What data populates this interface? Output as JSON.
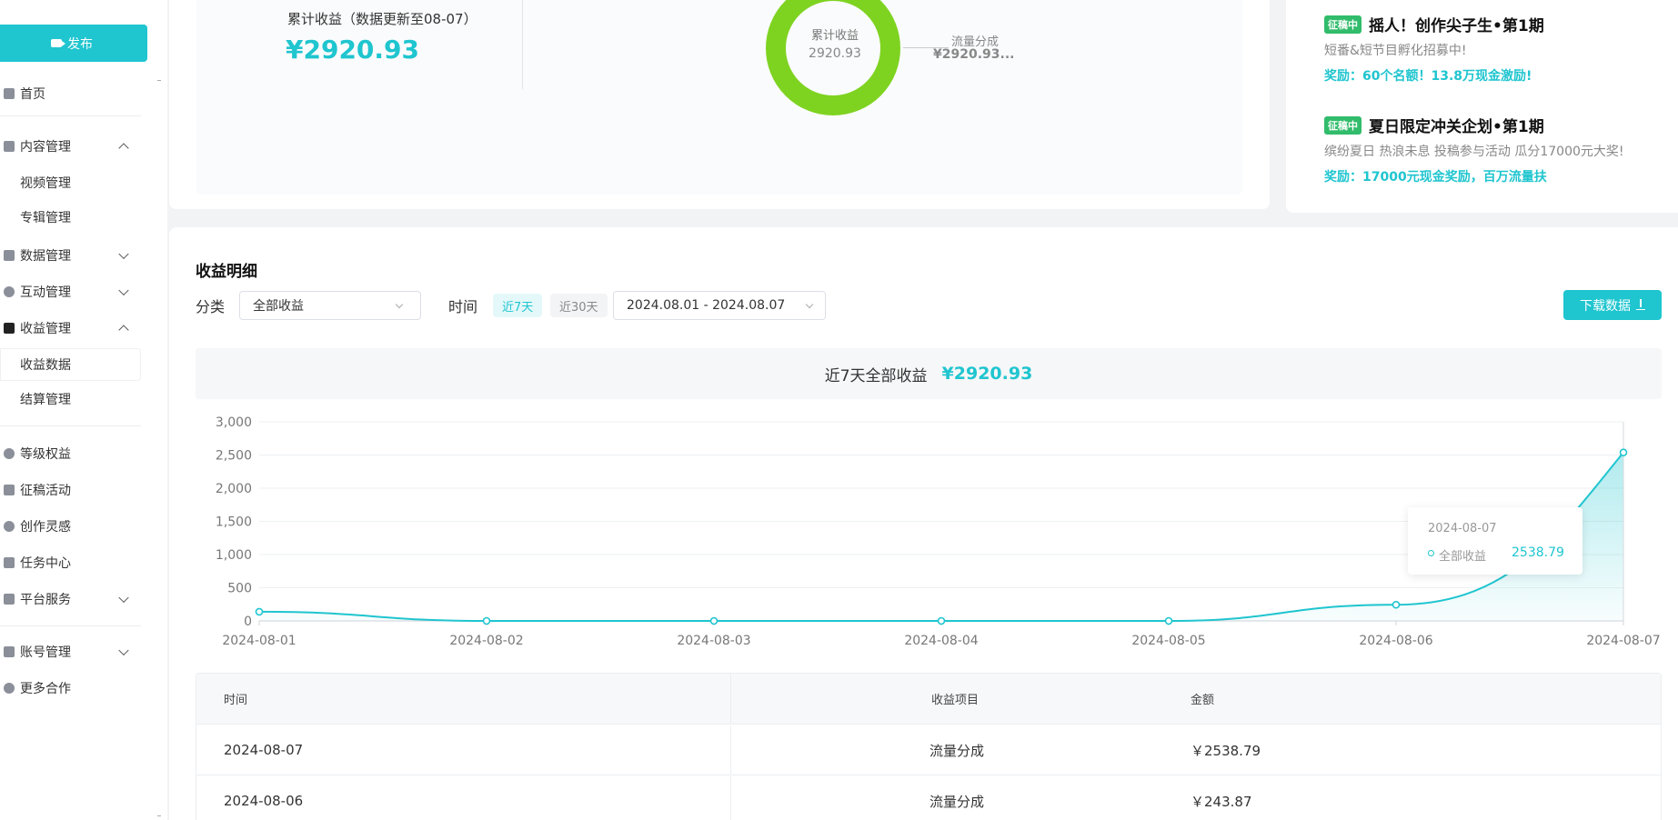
{
  "sidebar": {
    "publish_label": "发布",
    "items": {
      "home": "首页",
      "content": "内容管理",
      "video": "视频管理",
      "album": "专辑管理",
      "data": "数据管理",
      "interaction": "互动管理",
      "revenue": "收益管理",
      "revenue_data": "收益数据",
      "settlement": "结算管理",
      "level": "等级权益",
      "contest": "征稿活动",
      "inspiration": "创作灵感",
      "tasks": "任务中心",
      "platform": "平台服务",
      "account": "账号管理",
      "cooperation": "更多合作"
    }
  },
  "overview": {
    "total_label": "累计收益（数据更新至08-07）",
    "total_value": "¥2920.93",
    "donut_label": "累计收益",
    "donut_value": "2920.93",
    "legend_name": "流量分成",
    "legend_value": "¥2920.93..."
  },
  "promos": [
    {
      "badge": "征稿中",
      "title": "摇人！创作尖子生•第1期",
      "desc": "短番&短节目孵化招募中!",
      "reward": "奖励：60个名额！13.8万现金激励!"
    },
    {
      "badge": "征稿中",
      "title": "夏日限定冲关企划•第1期",
      "desc": "缤纷夏日 热浪未息 投稿参与活动 瓜分17000元大奖!",
      "reward": "奖励：17000元现金奖励，百万流量扶"
    }
  ],
  "detail": {
    "title": "收益明细",
    "category_label": "分类",
    "category_value": "全部收益",
    "time_label": "时间",
    "chip_7d": "近7天",
    "chip_30d": "近30天",
    "date_range": "2024.08.01 - 2024.08.07",
    "download_label": "下载数据",
    "summary_label": "近7天全部收益",
    "summary_value": "¥2920.93"
  },
  "tooltip": {
    "date": "2024-08-07",
    "series": "全部收益",
    "value": "2538.79"
  },
  "chart_data": {
    "type": "area",
    "x": [
      "2024-08-01",
      "2024-08-02",
      "2024-08-03",
      "2024-08-04",
      "2024-08-05",
      "2024-08-06",
      "2024-08-07"
    ],
    "series": [
      {
        "name": "全部收益",
        "values": [
          138.27,
          0,
          0,
          0,
          0,
          243.87,
          2538.79
        ]
      }
    ],
    "yticks": [
      "0",
      "500",
      "1,000",
      "1,500",
      "2,000",
      "2,500",
      "3,000"
    ],
    "ylim": [
      0,
      3000
    ],
    "grid": true,
    "line_color": "#1fc5cf"
  },
  "table": {
    "headers": [
      "时间",
      "收益项目",
      "金额"
    ],
    "rows": [
      [
        "2024-08-07",
        "流量分成",
        "￥2538.79"
      ],
      [
        "2024-08-06",
        "流量分成",
        "￥243.87"
      ]
    ]
  },
  "colors": {
    "accent": "#1fc5cf",
    "donut": "#7ed321",
    "badge": "#31bc6b"
  }
}
